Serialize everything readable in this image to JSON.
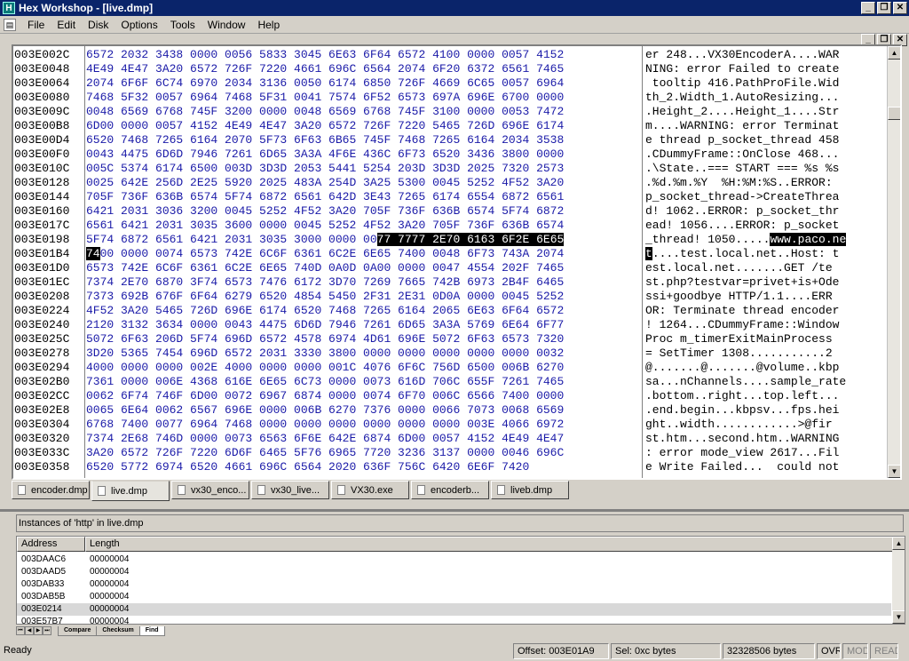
{
  "window": {
    "title": "Hex Workshop - [live.dmp]",
    "app_icon": "H"
  },
  "menu": {
    "items": [
      "File",
      "Edit",
      "Disk",
      "Options",
      "Tools",
      "Window",
      "Help"
    ]
  },
  "hex": {
    "addresses": [
      "003E002C",
      "003E0048",
      "003E0064",
      "003E0080",
      "003E009C",
      "003E00B8",
      "003E00D4",
      "003E00F0",
      "003E010C",
      "003E0128",
      "003E0144",
      "003E0160",
      "003E017C",
      "003E0198",
      "003E01B4",
      "003E01D0",
      "003E01EC",
      "003E0208",
      "003E0224",
      "003E0240",
      "003E025C",
      "003E0278",
      "003E0294",
      "003E02B0",
      "003E02CC",
      "003E02E8",
      "003E0304",
      "003E0320",
      "003E033C",
      "003E0358"
    ],
    "rows": [
      "6572 2032 3438 0000 0056 5833 3045 6E63 6F64 6572 4100 0000 0057 4152",
      "4E49 4E47 3A20 6572 726F 7220 4661 696C 6564 2074 6F20 6372 6561 7465",
      "2074 6F6F 6C74 6970 2034 3136 0050 6174 6850 726F 4669 6C65 0057 6964",
      "7468 5F32 0057 6964 7468 5F31 0041 7574 6F52 6573 697A 696E 6700 0000",
      "0048 6569 6768 745F 3200 0000 0048 6569 6768 745F 3100 0000 0053 7472",
      "6D00 0000 0057 4152 4E49 4E47 3A20 6572 726F 7220 5465 726D 696E 6174",
      "6520 7468 7265 6164 2070 5F73 6F63 6B65 745F 7468 7265 6164 2034 3538",
      "0043 4475 6D6D 7946 7261 6D65 3A3A 4F6E 436C 6F73 6520 3436 3800 0000",
      "005C 5374 6174 6500 003D 3D3D 2053 5441 5254 203D 3D3D 2025 7320 2573",
      "0025 642E 256D 2E25 5920 2025 483A 254D 3A25 5300 0045 5252 4F52 3A20",
      "705F 736F 636B 6574 5F74 6872 6561 642D 3E43 7265 6174 6554 6872 6561",
      "6421 2031 3036 3200 0045 5252 4F52 3A20 705F 736F 636B 6574 5F74 6872",
      "6561 6421 2031 3035 3600 0000 0045 5252 4F52 3A20 705F 736F 636B 6574",
      "5F74 6872 6561 6421 2031 3035 3000 0000 00",
      "",
      "6573 742E 6C6F 6361 6C2E 6E65 740D 0A0D 0A00 0000 0047 4554 202F 7465",
      "7374 2E70 6870 3F74 6573 7476 6172 3D70 7269 7665 742B 6973 2B4F 6465",
      "7373 692B 676F 6F64 6279 6520 4854 5450 2F31 2E31 0D0A 0000 0045 5252",
      "4F52 3A20 5465 726D 696E 6174 6520 7468 7265 6164 2065 6E63 6F64 6572",
      "2120 3132 3634 0000 0043 4475 6D6D 7946 7261 6D65 3A3A 5769 6E64 6F77",
      "5072 6F63 206D 5F74 696D 6572 4578 6974 4D61 696E 5072 6F63 6573 7320",
      "3D20 5365 7454 696D 6572 2031 3330 3800 0000 0000 0000 0000 0000 0032",
      "4000 0000 0000 002E 4000 0000 0000 001C 4076 6F6C 756D 6500 006B 6270",
      "7361 0000 006E 4368 616E 6E65 6C73 0000 0073 616D 706C 655F 7261 7465",
      "0062 6F74 746F 6D00 0072 6967 6874 0000 0074 6F70 006C 6566 7400 0000",
      "0065 6E64 0062 6567 696E 0000 006B 6270 7376 0000 0066 7073 0068 6569",
      "6768 7400 0077 6964 7468 0000 0000 0000 0000 0000 0000 003E 4066 6972",
      "7374 2E68 746D 0000 0073 6563 6F6E 642E 6874 6D00 0057 4152 4E49 4E47",
      "3A20 6572 726F 7220 6D6F 6465 5F76 6965 7720 3236 3137 0000 0046 696C",
      "6520 5772 6974 6520 4661 696C 6564 2020 636F 756C 6420 6E6F 7420"
    ],
    "row13_sel": "77 7777 2E70 6163 6F2E 6E65",
    "row14_sel": "74",
    "row14_rest": "00 0000 0074 6573 742E 6C6F 6361 6C2E 6E65 7400 0048 6F73 743A 2074",
    "ascii": [
      "er 248...VX30EncoderA....WAR",
      "NING: error Failed to create",
      " tooltip 416.PathProFile.Wid",
      "th_2.Width_1.AutoResizing...",
      ".Height_2....Height_1....Str",
      "m....WARNING: error Terminat",
      "e thread p_socket_thread 458",
      ".CDummyFrame::OnClose 468...",
      ".\\State..=== START === %s %s",
      ".%d.%m.%Y  %H:%M:%S..ERROR: ",
      "p_socket_thread->CreateThrea",
      "d! 1062..ERROR: p_socket_thr",
      "ead! 1056....ERROR: p_socket",
      "_thread! 1050.....",
      "",
      "est.local.net.......GET /te",
      "st.php?testvar=privet+is+Ode",
      "ssi+goodbye HTTP/1.1....ERR",
      "OR: Terminate thread encoder",
      "! 1264...CDummyFrame::Window",
      "Proc m_timerExitMainProcess ",
      "= SetTimer 1308...........2",
      "@.......@.......@volume..kbp",
      "sa...nChannels....sample_rate",
      ".bottom..right...top.left...",
      ".end.begin...kbpsv...fps.hei",
      "ght..width............>@fir",
      "st.htm...second.htm..WARNING",
      ": error mode_view 2617...Fil",
      "e Write Failed...  could not"
    ],
    "ascii13_sel": "www.paco.ne",
    "ascii14_sel": "t",
    "ascii14_rest": "....test.local.net..Host: t"
  },
  "tabs": [
    "encoder.dmp",
    "live.dmp",
    "vx30_enco...",
    "vx30_live...",
    "VX30.exe",
    "encoderb...",
    "liveb.dmp"
  ],
  "results": {
    "title": "Instances of 'http' in live.dmp",
    "headers": [
      "Address",
      "Length"
    ],
    "rows": [
      [
        "003DAAC6",
        "00000004"
      ],
      [
        "003DAAD5",
        "00000004"
      ],
      [
        "003DAB33",
        "00000004"
      ],
      [
        "003DAB5B",
        "00000004"
      ],
      [
        "003E0214",
        "00000004"
      ],
      [
        "003E57B7",
        "00000004"
      ]
    ],
    "bottom_tabs": [
      "Compare",
      "Checksum",
      "Find"
    ]
  },
  "status": {
    "ready": "Ready",
    "offset": "Offset: 003E01A9",
    "sel": "Sel: 0xc bytes",
    "size": "32328506 bytes",
    "ovr": "OVR",
    "mod": "MOD",
    "read": "READ"
  }
}
